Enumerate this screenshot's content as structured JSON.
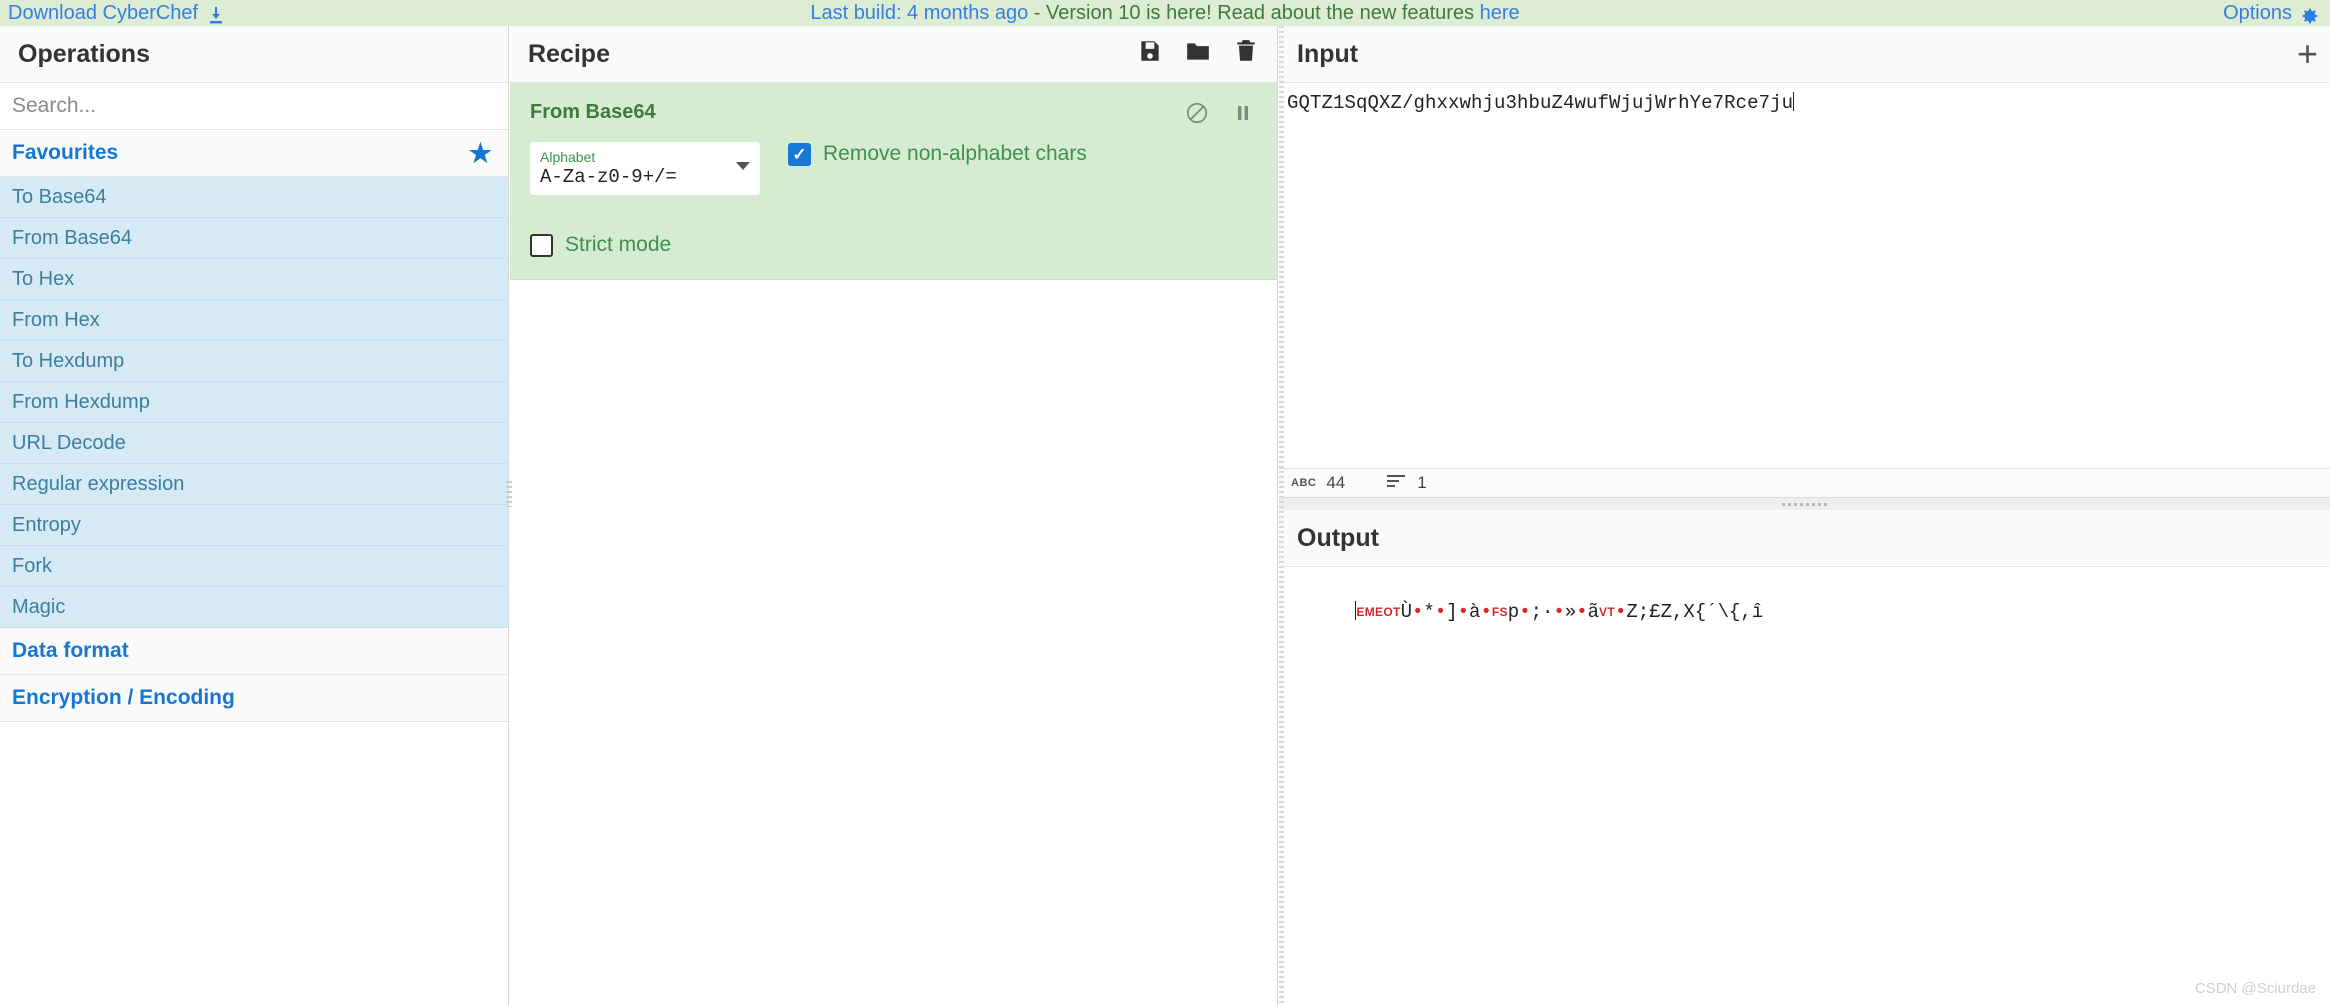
{
  "banner": {
    "download_label": "Download CyberChef",
    "download_icon": "download-icon",
    "last_build": "Last build: 4 months ago",
    "version_text": " - Version 10 is here! Read about the new features ",
    "here_link": "here",
    "options_label": "Options",
    "options_icon": "gear-icon",
    "bg_color": "#dcedd3",
    "link_color": "#3b7ddd",
    "green_text_color": "#3f7a3f"
  },
  "operations": {
    "title": "Operations",
    "search_placeholder": "Search...",
    "search_value": "",
    "categories": [
      {
        "label": "Favourites",
        "starred": true,
        "star_icon": "star-icon",
        "items": [
          "To Base64",
          "From Base64",
          "To Hex",
          "From Hex",
          "To Hexdump",
          "From Hexdump",
          "URL Decode",
          "Regular expression",
          "Entropy",
          "Fork",
          "Magic"
        ]
      },
      {
        "label": "Data format",
        "starred": false,
        "items": []
      },
      {
        "label": "Encryption / Encoding",
        "starred": false,
        "items": []
      }
    ],
    "item_bg": "#d5eaf5",
    "item_text_color": "#3d7ea0",
    "category_color": "#1577d4"
  },
  "recipe": {
    "title": "Recipe",
    "icons": [
      {
        "name": "save-icon",
        "label": "Save recipe"
      },
      {
        "name": "folder-icon",
        "label": "Load recipe"
      },
      {
        "name": "trash-icon",
        "label": "Clear recipe"
      }
    ],
    "operation": {
      "name": "From Base64",
      "disable_icon": "disable-icon",
      "pause_icon": "pause-icon",
      "args": {
        "alphabet_label": "Alphabet",
        "alphabet_value": "A-Za-z0-9+/=",
        "dropdown_icon": "chevron-down-icon",
        "remove_non_alphabet_label": "Remove non-alphabet chars",
        "remove_non_alphabet_checked": true,
        "strict_mode_label": "Strict mode",
        "strict_mode_checked": false
      },
      "bg_color": "#d5ecd0",
      "title_color": "#3f7a3f"
    }
  },
  "input": {
    "title": "Input",
    "add_tab_icon": "plus-icon",
    "value": "GQTZ1SqQXZ/ghxxwhju3hbuZ4wufWjujWrhYe7Rce7ju",
    "status": {
      "length_icon": "abc-icon",
      "length_glyph": "ABC",
      "length": "44",
      "lines_icon": "lines-icon",
      "lines": "1"
    }
  },
  "output": {
    "title": "Output",
    "segments": [
      {
        "kind": "control",
        "text": "EM"
      },
      {
        "kind": "control",
        "text": "EOT"
      },
      {
        "kind": "plain",
        "text": "Ù"
      },
      {
        "kind": "dot",
        "text": "•"
      },
      {
        "kind": "plain",
        "text": "*"
      },
      {
        "kind": "dot",
        "text": "•"
      },
      {
        "kind": "plain",
        "text": "]"
      },
      {
        "kind": "dot",
        "text": "•"
      },
      {
        "kind": "plain",
        "text": "à"
      },
      {
        "kind": "dot",
        "text": "•"
      },
      {
        "kind": "control",
        "text": "FS"
      },
      {
        "kind": "plain",
        "text": "p"
      },
      {
        "kind": "dot",
        "text": "•"
      },
      {
        "kind": "plain",
        "text": ";·"
      },
      {
        "kind": "dot",
        "text": "•"
      },
      {
        "kind": "plain",
        "text": "»"
      },
      {
        "kind": "dot",
        "text": "•"
      },
      {
        "kind": "plain",
        "text": "ã"
      },
      {
        "kind": "control",
        "text": "VT"
      },
      {
        "kind": "dot",
        "text": "•"
      },
      {
        "kind": "plain",
        "text": "Z;£Z,X{´\\{,î"
      }
    ]
  },
  "watermark": "CSDN @Sciurdae"
}
